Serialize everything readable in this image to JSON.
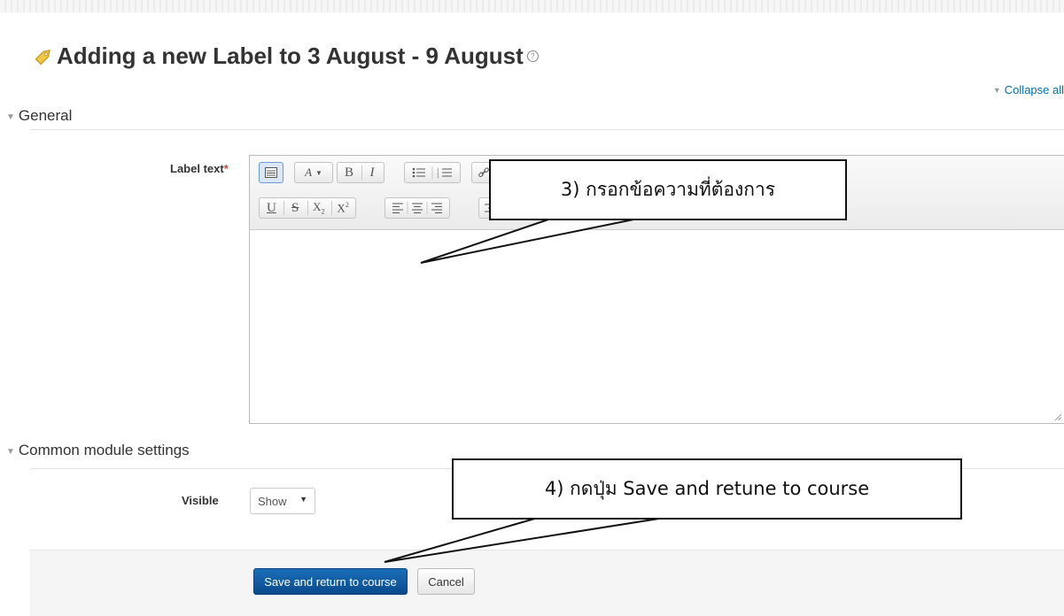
{
  "page": {
    "title": "Adding a new Label to 3 August - 9 August",
    "collapse_all": "Collapse all"
  },
  "sections": {
    "general": "General",
    "common": "Common module settings"
  },
  "form": {
    "label_text": "Label text",
    "required_mark": "*",
    "visible_label": "Visible",
    "visible_value": "Show"
  },
  "editor": {
    "toolbar_row1": [
      "show-more-buttons",
      "font-size",
      "bold",
      "italic",
      "unordered-list",
      "ordered-list",
      "link"
    ],
    "toolbar_row2": [
      "underline",
      "strikethrough",
      "subscript",
      "superscript",
      "align-left",
      "align-center",
      "align-right",
      "indent"
    ],
    "labels": {
      "font_size": "A",
      "bold": "B",
      "italic": "I",
      "underline": "U",
      "strike": "S",
      "sub": "X",
      "sub_idx": "2",
      "sup": "X",
      "sup_idx": "2"
    },
    "content": ""
  },
  "buttons": {
    "save": "Save and return to course",
    "cancel": "Cancel"
  },
  "annotations": {
    "step3": "3) กรอกข้อความที่ต้องการ",
    "step4": "4) กดปุ่ม Save and retune to course"
  },
  "colors": {
    "primary_button": "#0a56a0",
    "link": "#0070a8",
    "required": "#b94a48"
  }
}
